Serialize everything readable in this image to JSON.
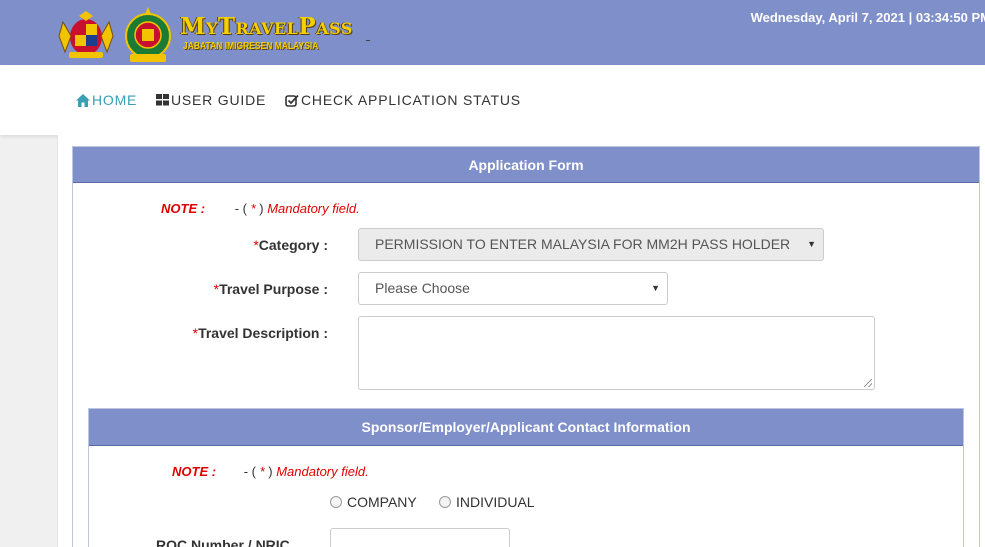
{
  "header": {
    "brand_title": "MyTravelPass",
    "brand_subtitle": "JABATAN IMIGRESEN MALAYSIA",
    "datetime": "Wednesday, April 7, 2021 | 03:34:50 PM",
    "colors": {
      "bar": "#7f8fca",
      "brand_text": "#f5d000"
    }
  },
  "nav": {
    "home": {
      "label": "HOME",
      "icon": "home-icon"
    },
    "guide": {
      "label": "USER GUIDE",
      "icon": "grid-icon"
    },
    "status": {
      "label": "CHECK APPLICATION STATUS",
      "icon": "check-square-icon"
    }
  },
  "application_form": {
    "title": "Application Form",
    "note_label": "NOTE :",
    "note_dash": "- (",
    "note_star": " * ",
    "note_close": ")",
    "note_text": " Mandatory field.",
    "category": {
      "required_mark": "*",
      "label": "Category :",
      "value": "PERMISSION TO ENTER MALAYSIA FOR MM2H PASS HOLDER"
    },
    "travel_purpose": {
      "required_mark": "*",
      "label": "Travel Purpose :",
      "value": "Please Choose"
    },
    "travel_description": {
      "required_mark": "*",
      "label": "Travel Description :",
      "value": ""
    }
  },
  "contact_section": {
    "title": "Sponsor/Employer/Applicant Contact Information",
    "note_label": "NOTE :",
    "note_dash": "- (",
    "note_star": " * ",
    "note_close": ")",
    "note_text": " Mandatory field.",
    "radio_company": "COMPANY",
    "radio_individual": "INDIVIDUAL",
    "roc_label": "ROC Number / NRIC",
    "roc_value": ""
  }
}
